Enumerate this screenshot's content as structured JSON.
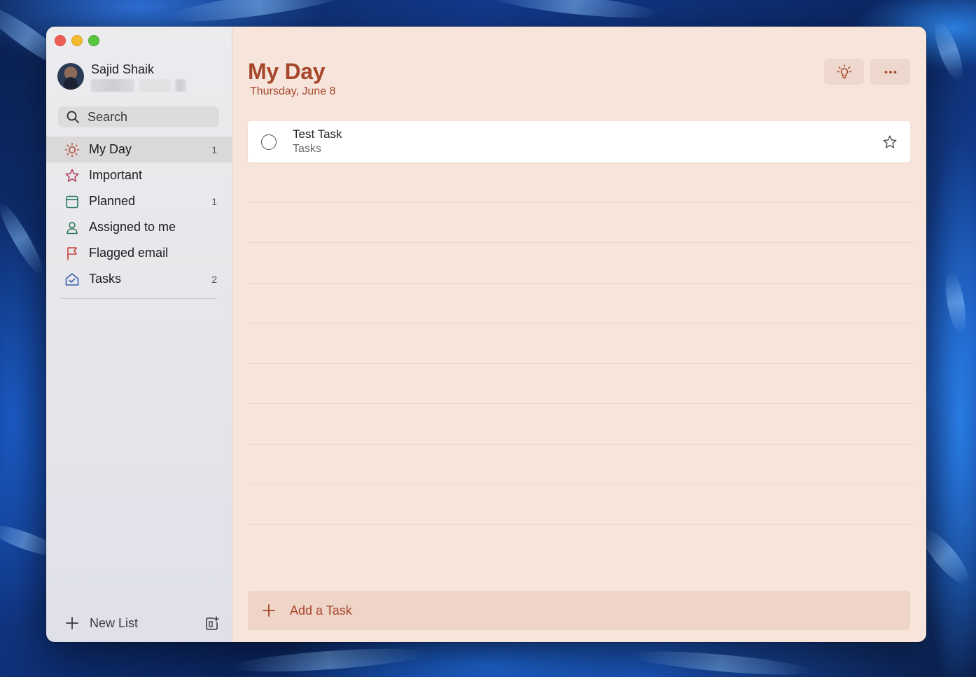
{
  "window": {
    "traffic_lights": [
      "close",
      "minimize",
      "zoom"
    ]
  },
  "profile": {
    "name": "Sajid Shaik"
  },
  "search": {
    "label": "Search",
    "icon": "search-icon"
  },
  "sidebar": {
    "items": [
      {
        "label": "My Day",
        "count": "1",
        "icon": "sun-icon",
        "color": "#b5533c",
        "active": true
      },
      {
        "label": "Important",
        "count": "",
        "icon": "star-icon",
        "color": "#b3455c"
      },
      {
        "label": "Planned",
        "count": "1",
        "icon": "calendar-icon",
        "color": "#1f7a5c"
      },
      {
        "label": "Assigned to me",
        "count": "",
        "icon": "person-icon",
        "color": "#2f7a5a"
      },
      {
        "label": "Flagged email",
        "count": "",
        "icon": "flag-icon",
        "color": "#c8413d"
      },
      {
        "label": "Tasks",
        "count": "2",
        "icon": "home-check-icon",
        "color": "#3d5fb0"
      }
    ],
    "footer": {
      "new_list_label": "New List"
    }
  },
  "main": {
    "title": "My Day",
    "subtitle": "Thursday, June 8",
    "accent_color": "#a6462a",
    "background": "#f7e5dc",
    "tasks": [
      {
        "title": "Test Task",
        "list": "Tasks",
        "starred": false
      }
    ],
    "add_task_label": "Add a Task"
  }
}
